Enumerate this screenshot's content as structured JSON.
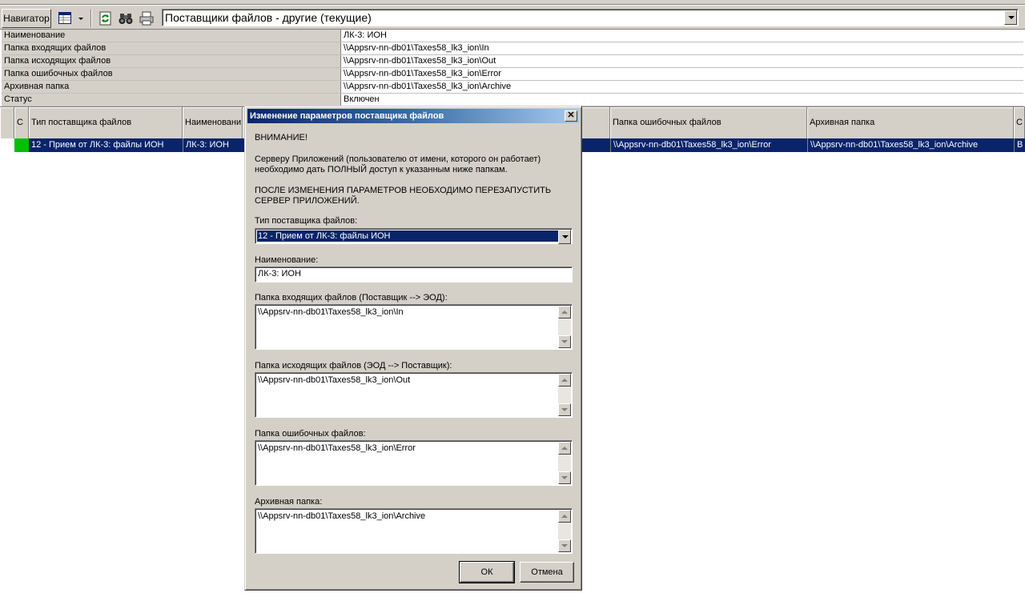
{
  "toolbar": {
    "navigator_label": "Навигатор",
    "view_icon": "grid-view-icon",
    "refresh_icon": "refresh-icon",
    "find_icon": "binoculars-icon",
    "print_icon": "printer-icon",
    "selection": "Поставщики файлов - другие (текущие)"
  },
  "properties": [
    {
      "label": "Наименование",
      "value": "ЛК-3: ИОН"
    },
    {
      "label": "Папка входящих файлов",
      "value": "\\\\Appsrv-nn-db01\\Taxes58_lk3_ion\\In"
    },
    {
      "label": "Папка исходящих файлов",
      "value": "\\\\Appsrv-nn-db01\\Taxes58_lk3_ion\\Out"
    },
    {
      "label": "Папка ошибочных файлов",
      "value": "\\\\Appsrv-nn-db01\\Taxes58_lk3_ion\\Error"
    },
    {
      "label": "Архивная папка",
      "value": "\\\\Appsrv-nn-db01\\Taxes58_lk3_ion\\Archive"
    },
    {
      "label": "Статус",
      "value": "Включен"
    }
  ],
  "grid": {
    "headers": {
      "col_c": "С",
      "type": "Тип поставщика файлов",
      "name": "Наименовани",
      "error_folder": "Папка ошибочных файлов",
      "archive_folder": "Архивная папка",
      "status": "С"
    },
    "row": {
      "status_color": "#00c000",
      "type": "12 - Прием от ЛК-3: файлы ИОН",
      "name": "ЛК-3: ИОН",
      "error_folder": "\\\\Appsrv-nn-db01\\Taxes58_lk3_ion\\Error",
      "archive_folder": "\\\\Appsrv-nn-db01\\Taxes58_lk3_ion\\Archive",
      "status": "В"
    }
  },
  "dialog": {
    "title": "Изменение параметров поставщика файлов",
    "close_glyph": "✕",
    "warning_title": "ВНИМАНИЕ!",
    "warning_text": "Серверу Приложений (пользователю от имени, которого он работает) необходимо дать ПОЛНЫЙ доступ к указанным ниже папкам.",
    "restart_text": "ПОСЛЕ ИЗМЕНЕНИЯ ПАРАМЕТРОВ НЕОБХОДИМО ПЕРЕЗАПУСТИТЬ СЕРВЕР ПРИЛОЖЕНИЙ.",
    "type_label": "Тип поставщика файлов:",
    "type_value": "12 - Прием от ЛК-3: файлы ИОН",
    "name_label": "Наименование:",
    "name_value": "ЛК-3: ИОН",
    "in_label": "Папка входящих файлов (Поставщик --> ЭОД):",
    "in_value": "\\\\Appsrv-nn-db01\\Taxes58_lk3_ion\\In",
    "out_label": "Папка исходящих файлов (ЭОД --> Поставщик):",
    "out_value": "\\\\Appsrv-nn-db01\\Taxes58_lk3_ion\\Out",
    "error_label": "Папка ошибочных файлов:",
    "error_value": "\\\\Appsrv-nn-db01\\Taxes58_lk3_ion\\Error",
    "archive_label": "Архивная папка:",
    "archive_value": "\\\\Appsrv-nn-db01\\Taxes58_lk3_ion\\Archive",
    "ok_label": "ОК",
    "cancel_label": "Отмена"
  }
}
